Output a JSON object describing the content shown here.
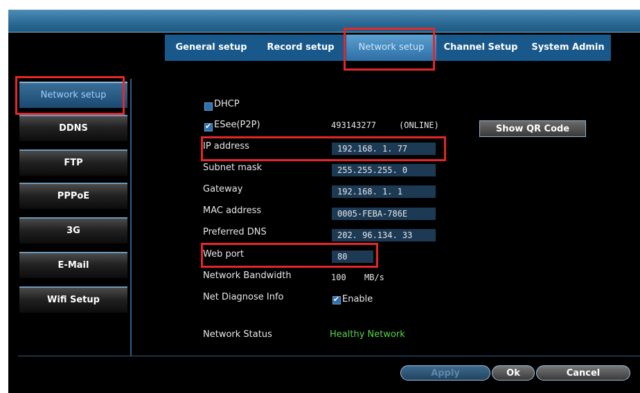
{
  "tabs": [
    {
      "label": "General setup"
    },
    {
      "label": "Record setup"
    },
    {
      "label": "Network setup"
    },
    {
      "label": "Channel Setup"
    },
    {
      "label": "System Admin"
    }
  ],
  "sidebar": {
    "items": [
      {
        "label": "Network setup"
      },
      {
        "label": "DDNS"
      },
      {
        "label": "FTP"
      },
      {
        "label": "PPPoE"
      },
      {
        "label": "3G"
      },
      {
        "label": "E-Mail"
      },
      {
        "label": "Wifi Setup"
      }
    ]
  },
  "form": {
    "dhcp_label": "DHCP",
    "dhcp_checked": false,
    "esee_label": "ESee(P2P)",
    "esee_checked": true,
    "esee_id": "493143277",
    "esee_status": "(ONLINE)",
    "show_qr_label": "Show QR Code",
    "ip_label": "IP address",
    "ip_value": "192.168.  1. 77",
    "subnet_label": "Subnet mask",
    "subnet_value": "255.255.255.  0",
    "gateway_label": "Gateway",
    "gateway_value": "192.168.  1.  1",
    "mac_label": "MAC address",
    "mac_value": "0005-FEBA-786E",
    "dns_label": "Preferred DNS",
    "dns_value": "202. 96.134. 33",
    "webport_label": "Web port",
    "webport_value": "80",
    "bandwidth_label": "Network Bandwidth",
    "bandwidth_value": "100",
    "bandwidth_unit": "MB/s",
    "diagnose_label": "Net Diagnose Info",
    "diagnose_enable_label": "Enable",
    "diagnose_checked": true,
    "status_label": "Network Status",
    "status_value": "Healthy Network"
  },
  "buttons": {
    "apply": "Apply",
    "ok": "Ok",
    "cancel": "Cancel"
  },
  "colors": {
    "highlight_red": "#e5262a",
    "status_green": "#57d44a",
    "tab_bar": "#19588b"
  }
}
